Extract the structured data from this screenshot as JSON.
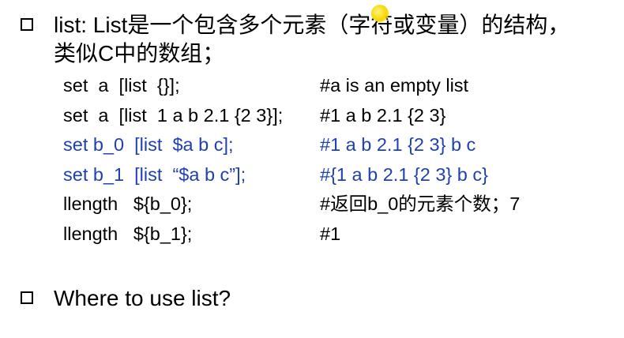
{
  "bullets": [
    {
      "line1": "list: List是一个包含多个元素（字符或变量）的结构，",
      "line2": "类似C中的数组；"
    },
    {
      "line1": "Where to use list?"
    }
  ],
  "code_lines": [
    {
      "cmd": "set  a  [list  {}];",
      "comment": "#a is an empty list",
      "color": "#000000"
    },
    {
      "cmd": "set  a  [list  1 a b 2.1 {2 3}];",
      "comment": "#1 a b 2.1 {2 3}",
      "color": "#000000"
    },
    {
      "cmd": "set b_0  [list  $a b c];",
      "comment": "#1 a b 2.1 {2 3} b c",
      "color": "#1f3fb4"
    },
    {
      "cmd": "set b_1  [list  “$a b c”];",
      "comment": "#{1 a b 2.1 {2 3} b c}",
      "color": "#1f3fb4"
    },
    {
      "cmd": "llength   ${b_0};",
      "comment": "#返回b_0的元素个数；7",
      "color": "#000000"
    },
    {
      "cmd": "llength   ${b_1};",
      "comment": "#1",
      "color": "#000000"
    }
  ],
  "colors": {
    "text": "#000000",
    "highlight_blue": "#1f3fb4",
    "cursor": "#f5d800"
  }
}
